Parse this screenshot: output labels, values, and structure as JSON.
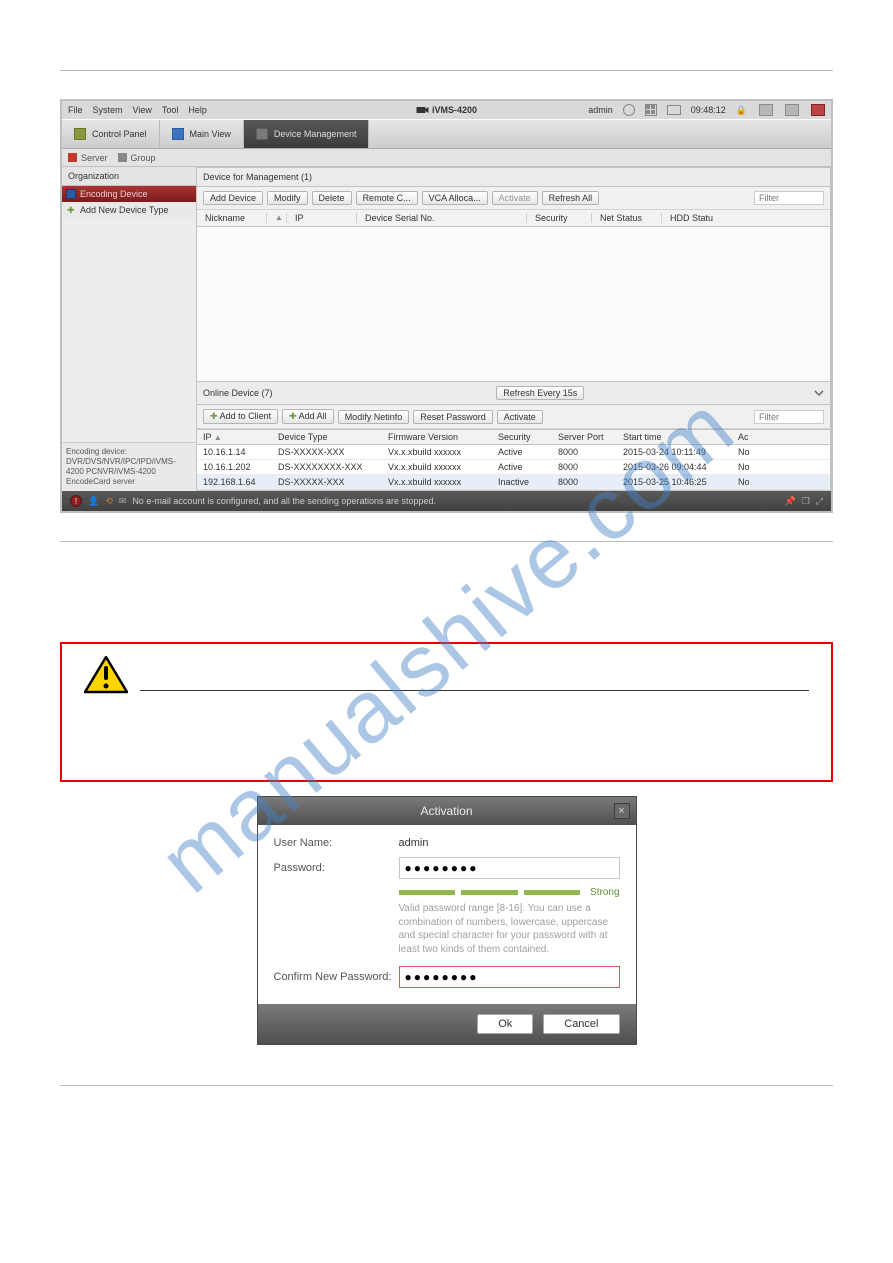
{
  "watermark": "manualshive.com",
  "ss": {
    "menu": [
      "File",
      "System",
      "View",
      "Tool",
      "Help"
    ],
    "title": "iVMS-4200",
    "user": "admin",
    "clock": "09:48:12",
    "tabs": [
      {
        "label": "Control Panel"
      },
      {
        "label": "Main View"
      },
      {
        "label": "Device Management"
      }
    ],
    "subtabs": [
      "Server",
      "Group"
    ],
    "sidebar": {
      "heading": "Organization",
      "items": [
        {
          "label": "Encoding Device"
        },
        {
          "label": "Add New Device Type"
        }
      ],
      "footer": "Encoding device:\nDVR/DVS/NVR/IPC/IPD/iVMS-4200 PCNVR/iVMS-4200 EncodeCard server"
    },
    "managementPanel": {
      "heading": "Device for Management (1)",
      "buttons": [
        "Add Device",
        "Modify",
        "Delete",
        "Remote C...",
        "VCA Alloca...",
        "Activate",
        "Refresh All"
      ],
      "filterPlaceholder": "Filter",
      "columns": [
        "Nickname",
        "IP",
        "Device Serial No.",
        "Security",
        "Net Status",
        "HDD Statu"
      ]
    },
    "onlinePanel": {
      "heading": "Online Device (7)",
      "refreshBtn": "Refresh Every 15s",
      "buttons": [
        "Add to Client",
        "Add All",
        "Modify Netinfo",
        "Reset Password",
        "Activate"
      ],
      "filterPlaceholder": "Filter",
      "columns": [
        "IP",
        "Device Type",
        "Firmware Version",
        "Security",
        "Server Port",
        "Start time",
        "Ac"
      ],
      "rows": [
        {
          "ip": "10.16.1.14",
          "dtype": "DS-XXXXX-XXX",
          "fw": "Vx.x.xbuild xxxxxx",
          "sec": "Active",
          "port": "8000",
          "start": "2015-03-24 10:11:49",
          "ac": "No"
        },
        {
          "ip": "10.16.1.202",
          "dtype": "DS-XXXXXXXX-XXX",
          "fw": "Vx.x.xbuild xxxxxx",
          "sec": "Active",
          "port": "8000",
          "start": "2015-03-26 09:04:44",
          "ac": "No"
        },
        {
          "ip": "192.168.1.64",
          "dtype": "DS-XXXXX-XXX",
          "fw": "Vx.x.xbuild xxxxxx",
          "sec": "Inactive",
          "port": "8000",
          "start": "2015-03-25 10:46:25",
          "ac": "No"
        }
      ]
    },
    "statusbar": "No e-mail account is configured, and all the sending operations are stopped."
  },
  "activation": {
    "title": "Activation",
    "userLabel": "User Name:",
    "userValue": "admin",
    "pwdLabel": "Password:",
    "pwdValue": "●●●●●●●●",
    "strength": "Strong",
    "hint": "Valid password range [8-16]. You can use a combination of numbers, lowercase, uppercase and special character for your password with at least two kinds of them contained.",
    "confirmLabel": "Confirm New Password:",
    "confirmValue": "●●●●●●●●",
    "okBtn": "Ok",
    "cancelBtn": "Cancel"
  }
}
